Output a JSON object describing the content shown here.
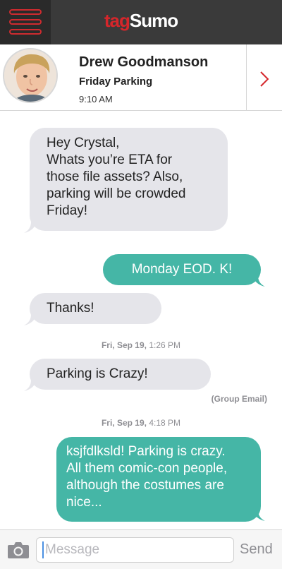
{
  "app": {
    "brand_part1": "tag",
    "brand_part2": "Sumo"
  },
  "contact": {
    "name": "Drew Goodmanson",
    "subject": "Friday Parking",
    "time": "9:10 AM"
  },
  "messages": [
    {
      "direction": "incoming",
      "lines": [
        "Hey Crystal,",
        "Whats you’re ETA for",
        "those file assets? Also,",
        "parking will be crowded",
        "Friday!"
      ]
    },
    {
      "direction": "outgoing",
      "lines": [
        "Monday EOD. K!"
      ]
    },
    {
      "direction": "incoming",
      "lines": [
        "Thanks!"
      ]
    },
    {
      "direction": "incoming",
      "lines": [
        "Parking is Crazy!"
      ]
    },
    {
      "direction": "outgoing",
      "lines": [
        "ksjfdlksld! Parking is crazy.",
        "All them comic-con people,",
        "although the costumes are",
        "nice..."
      ]
    }
  ],
  "timestamps": [
    {
      "date": "Fri, Sep 19,",
      "time": "1:26 PM"
    },
    {
      "date": "Fri, Sep 19,",
      "time": "4:18 PM"
    }
  ],
  "notes": {
    "group_email": "(Group Email)"
  },
  "composer": {
    "placeholder": "Message",
    "send_label": "Send"
  },
  "icons": {
    "menu": "hamburger-menu-icon",
    "chevron": "chevron-right-icon",
    "camera": "camera-icon"
  },
  "colors": {
    "accent_red": "#d5262b",
    "outgoing_bubble": "#45b6a6",
    "incoming_bubble": "#e5e5ea",
    "topbar": "#3a3a3a"
  }
}
